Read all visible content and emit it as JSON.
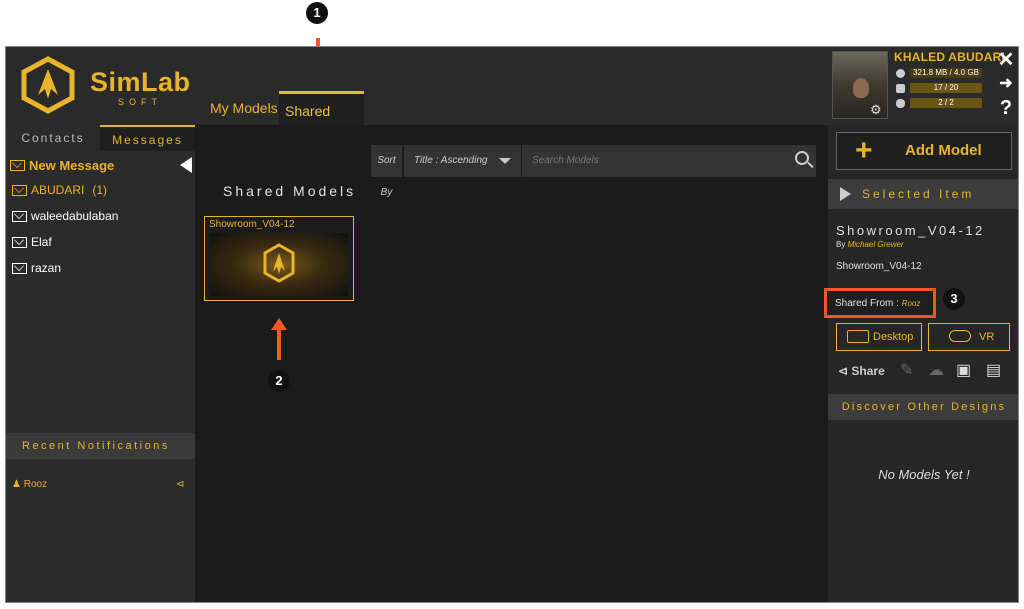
{
  "brand": {
    "name": "SimLab",
    "sub": "SOFT"
  },
  "tabs": {
    "my_models": "My Models",
    "shared_models": "Shared Models"
  },
  "left": {
    "contacts_tab": "Contacts",
    "messages_tab": "Messages",
    "new_message": "New Message",
    "contacts": [
      {
        "name": "ABUDARI",
        "count": "(1)"
      },
      {
        "name": "waleedabulaban",
        "count": ""
      },
      {
        "name": "Elaf",
        "count": ""
      },
      {
        "name": "razan",
        "count": ""
      }
    ],
    "notifications_title": "Recent Notifications",
    "notifications": [
      {
        "name": "Rooz"
      }
    ]
  },
  "main": {
    "sort_label": "Sort By",
    "sort_value": "Title : Ascending",
    "search_placeholder": "Search Models",
    "section_title": "Shared Models",
    "cards": [
      {
        "title": "Showroom_V04-12"
      }
    ]
  },
  "profile": {
    "name": "KHALED ABUDARI",
    "storage": "321.8 MB / 4.0 GB",
    "models": "17 / 20",
    "links": "2 / 2"
  },
  "right": {
    "add_model": "Add Model",
    "selected_item_title": "Selected Item",
    "selected_name": "Showroom_V04-12",
    "by_label": "By",
    "by_author": "Michael Grewer",
    "description": "Showroom_V04-12",
    "shared_from_label": "Shared From :",
    "shared_from_value": "Rooz",
    "desktop_btn": "Desktop",
    "vr_btn": "VR",
    "share_btn": "Share",
    "discover_title": "Discover Other Designs",
    "no_models": "No Models Yet !"
  },
  "annotations": {
    "one": "1",
    "two": "2",
    "three": "3"
  },
  "colors": {
    "accent": "#e9b32a",
    "annotation": "#f05a22",
    "background": "#1b1b1b"
  }
}
